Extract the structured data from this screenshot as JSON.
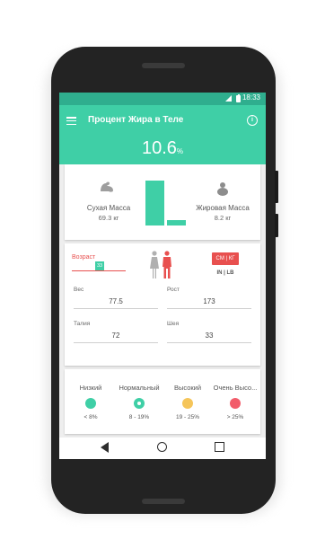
{
  "status_bar": {
    "time": "18:33"
  },
  "app_bar": {
    "title": "Процент Жира в Теле"
  },
  "summary": {
    "body_fat": "10.6",
    "unit": "%"
  },
  "lean_mass": {
    "label": "Сухая Масса",
    "value": "69.3 кг",
    "fraction": 0.894
  },
  "fat_mass": {
    "label": "Жировая Масса",
    "value": "8.2 кг",
    "fraction": 0.106
  },
  "inputs": {
    "age_label": "Возраст",
    "age_chip": "33",
    "unit_toggle": "СМ | КГ",
    "unit_alt": "IN | LB",
    "weight": {
      "label": "Вес",
      "value": "77.5"
    },
    "height": {
      "label": "Рост",
      "value": "173"
    },
    "waist": {
      "label": "Талия",
      "value": "72"
    },
    "neck": {
      "label": "Шея",
      "value": "33"
    }
  },
  "categories": [
    {
      "name": "Низкий",
      "range": "< 8%",
      "color": "#3fcfa6",
      "icon": "dot-icon"
    },
    {
      "name": "Нормальный",
      "range": "8 - 19%",
      "color": "#3fcfa6",
      "icon": "check-dot-icon"
    },
    {
      "name": "Высокий",
      "range": "19 - 25%",
      "color": "#f5c55a",
      "icon": "dot-icon"
    },
    {
      "name": "Очень Высо...",
      "range": "> 25%",
      "color": "#f25d6b",
      "icon": "dot-icon"
    }
  ],
  "colors": {
    "accent": "#3fcfa6",
    "accent_dark": "#2fae8e",
    "warn": "#e8504f"
  }
}
